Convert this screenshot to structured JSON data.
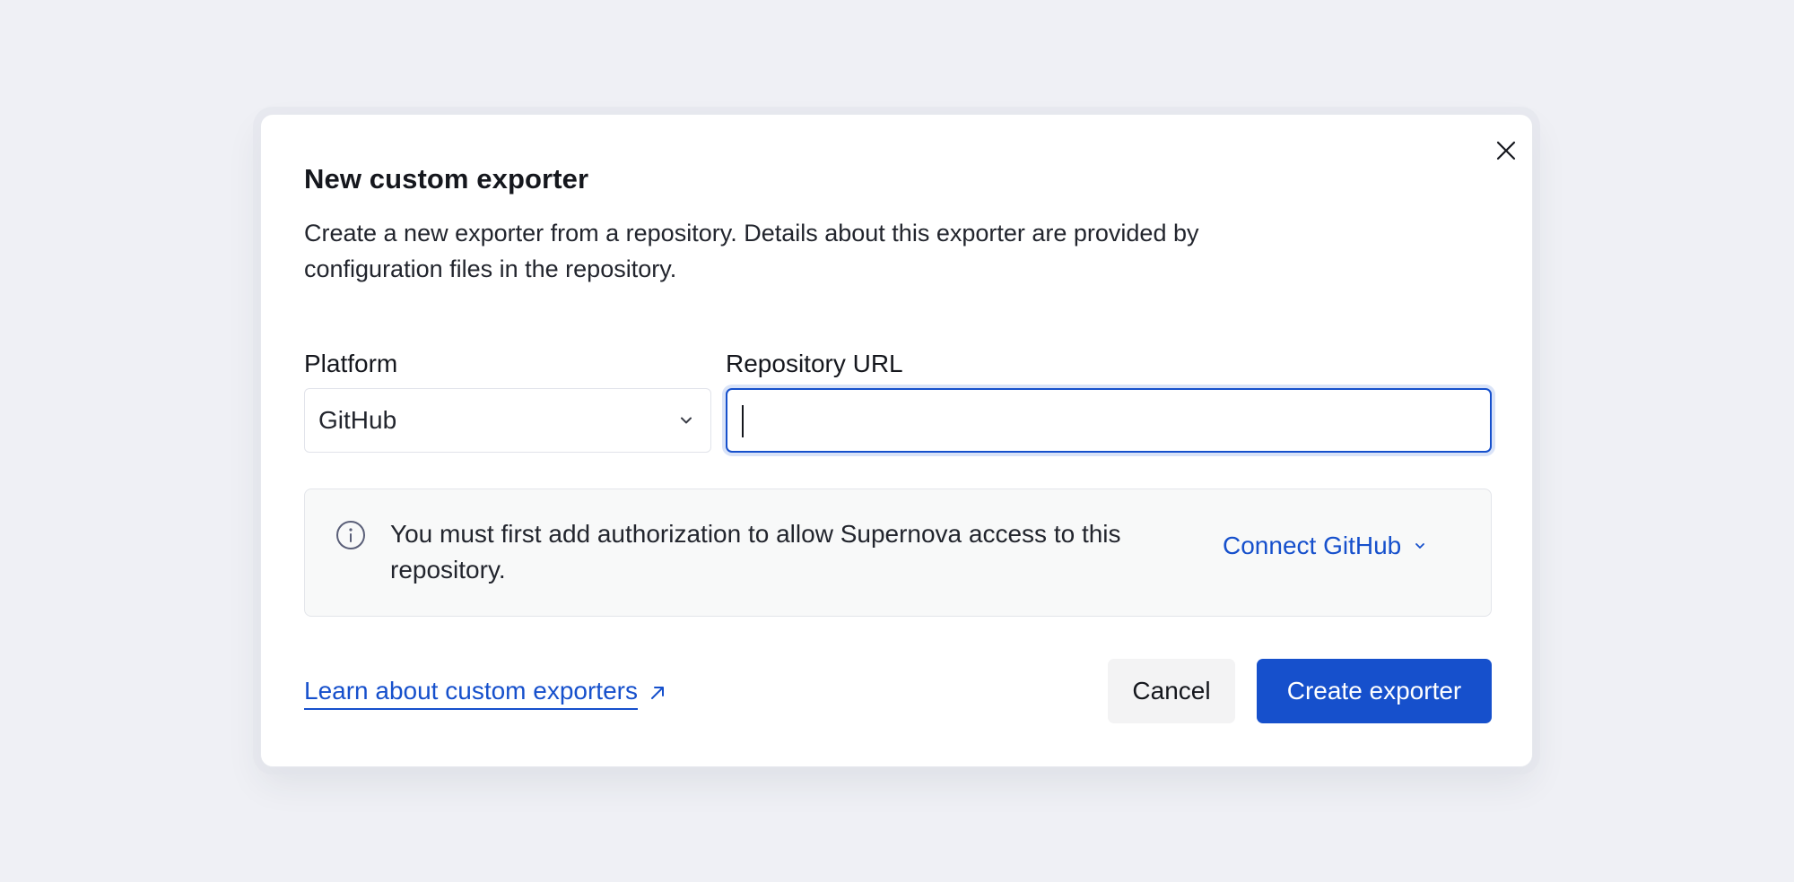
{
  "modal": {
    "title": "New custom exporter",
    "description": "Create a new exporter from a repository. Details about this exporter are provided by configuration files in the repository.",
    "close_icon": "close-icon"
  },
  "form": {
    "platform_label": "Platform",
    "platform_value": "GitHub",
    "platform_icon": "chevron-down-icon",
    "repo_label": "Repository URL",
    "repo_value": "",
    "repo_placeholder": ""
  },
  "info": {
    "icon": "info-icon",
    "text": "You must first add authorization to allow Supernova access to this repository.",
    "connect_label": "Connect GitHub",
    "connect_icon": "chevron-down-icon"
  },
  "footer": {
    "learn_label": "Learn about custom exporters",
    "learn_icon": "external-arrow-icon",
    "cancel_label": "Cancel",
    "create_label": "Create exporter"
  },
  "colors": {
    "background": "#eff0f5",
    "accent": "#1650cc",
    "focus_ring": "#d9e3f8",
    "info_bg": "#f8f9f9"
  }
}
